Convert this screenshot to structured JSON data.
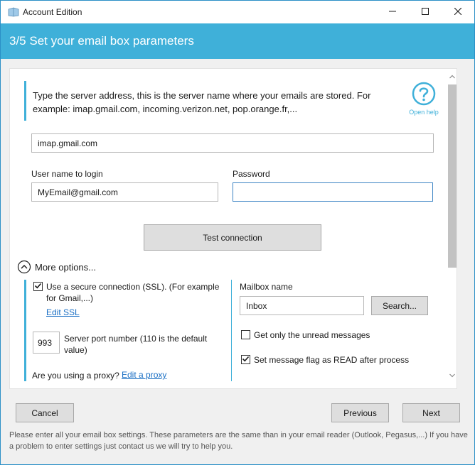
{
  "window": {
    "title": "Account Edition"
  },
  "header": {
    "title": "3/5  Set your email box parameters"
  },
  "info": {
    "text": "Type the server address, this is the server name where your emails are stored. For example: imap.gmail.com, incoming.verizon.net, pop.orange.fr,...",
    "help_label": "Open help"
  },
  "server": {
    "value": "imap.gmail.com"
  },
  "login": {
    "username_label": "User name to login",
    "username_value": "MyEmail@gmail.com",
    "password_label": "Password",
    "password_value": ""
  },
  "test_button": "Test connection",
  "more_options": {
    "label": "More options..."
  },
  "options": {
    "ssl_label": "Use a secure connection (SSL). (For example for Gmail,...)",
    "ssl_checked": true,
    "edit_ssl": "Edit SSL",
    "port_value": "993",
    "port_label": "Server port number (110 is the default value)",
    "proxy_question": "Are you using a proxy?",
    "edit_proxy": "Edit a proxy",
    "mailbox_label": "Mailbox name",
    "mailbox_value": "Inbox",
    "search_button": "Search...",
    "unread_label": "Get only the unread messages",
    "unread_checked": false,
    "read_flag_label": "Set message flag as READ after process",
    "read_flag_checked": true
  },
  "buttons": {
    "cancel": "Cancel",
    "previous": "Previous",
    "next": "Next"
  },
  "footer": {
    "text": "Please enter all your email box settings. These parameters are the same than in your email reader (Outlook, Pegasus,...) If you have a problem to enter settings just contact us we will try to help you."
  },
  "colors": {
    "accent": "#3fb0d9",
    "link": "#1a6fc4"
  }
}
